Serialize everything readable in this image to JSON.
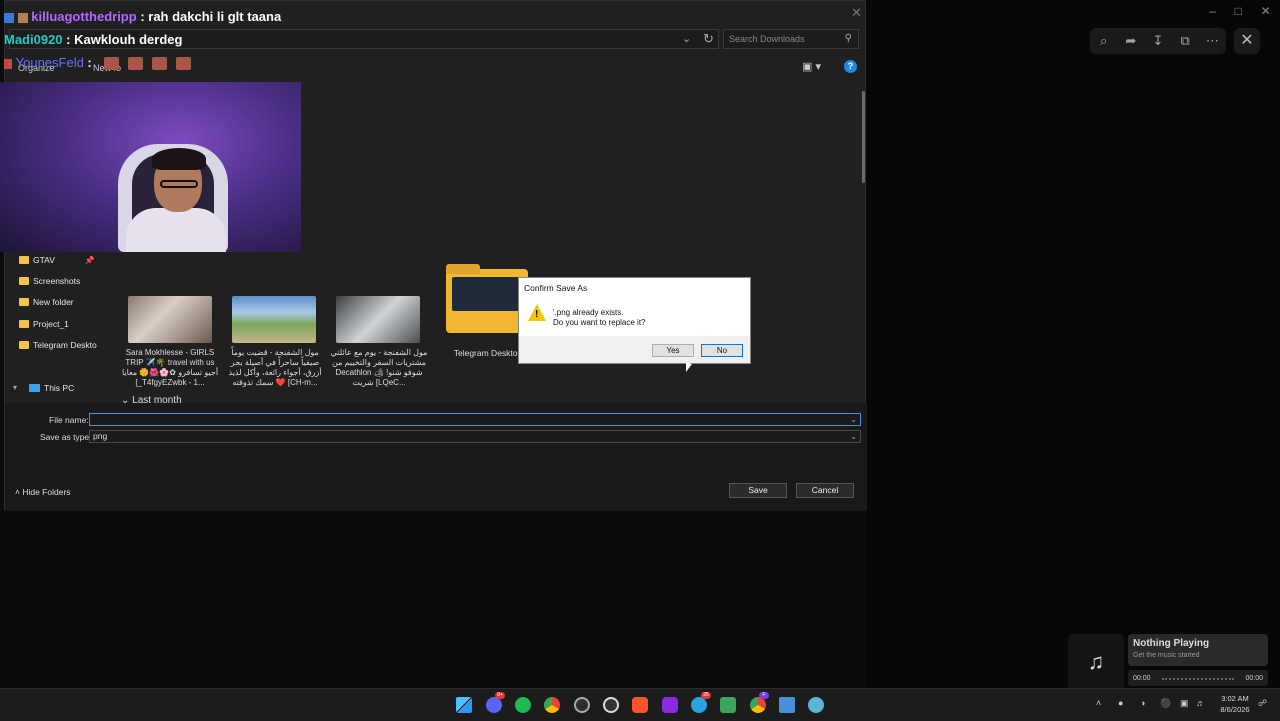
{
  "chat": [
    {
      "user": "killuagotthedripp",
      "message": " : rah dakchi li glt taana"
    },
    {
      "user": "Madi0920",
      "message": " : Kawklouh derdeg"
    },
    {
      "user": "YounesFeld",
      "message": " :"
    }
  ],
  "save_dialog": {
    "search_placeholder": "Search Downloads",
    "toolbar": {
      "organize": "Organize",
      "new_folder": "New fo"
    },
    "nav": {
      "quick_access": [
        "GTAV",
        "Screenshots",
        "New folder",
        "Project_1",
        "Telegram Deskto"
      ],
      "this_pc": "This PC"
    },
    "files": [
      {
        "caption": "Sara Mokhlesse - GIRLS TRIP ✈️🌴 travel with us أجيو تسافرو ✿🌸🌺🌼 معايا [_T4fgyEZwbk - 1..."
      },
      {
        "caption": "مول الشفنجة - قضيت يوماً صيفياً ساحراً في أصيلة بحر أزرق، أجواء رائعة، وأكل لذيذ ❤️ سمك تذوقته [CH-m..."
      },
      {
        "caption": "مول الشفنجة - يوم مع عائلتي مشتريات السفر والتخييم من Decathlon 🏕 !شوفو شنو شريت [LQeC..."
      },
      {
        "caption": "Telegram Desktop"
      }
    ],
    "group_label": "Last month",
    "file_name_label": "File name:",
    "file_name_value": "",
    "save_as_type_label": "Save as type:",
    "save_as_type_value": "png",
    "hide_folders": "Hide Folders",
    "save_button": "Save",
    "cancel_button": "Cancel"
  },
  "confirm": {
    "title": "Confirm Save As",
    "line1": "'.png already exists.",
    "line2": "Do you want to replace it?",
    "yes": "Yes",
    "no": "No"
  },
  "now_playing": {
    "title": "Nothing Playing",
    "subtitle": "Get the music started",
    "time_start": "00:00",
    "time_end": "00:00"
  },
  "taskbar": {
    "time": "3:02 AM",
    "date": "8/6/2026",
    "badges": {
      "discord": "9+",
      "telegram": "25",
      "chrome_profile": "F"
    }
  },
  "colors": {
    "accent": "#0078d7",
    "warning": "#f7c600",
    "chat_user1": "#b469ff",
    "chat_user2": "#27c7c7"
  }
}
